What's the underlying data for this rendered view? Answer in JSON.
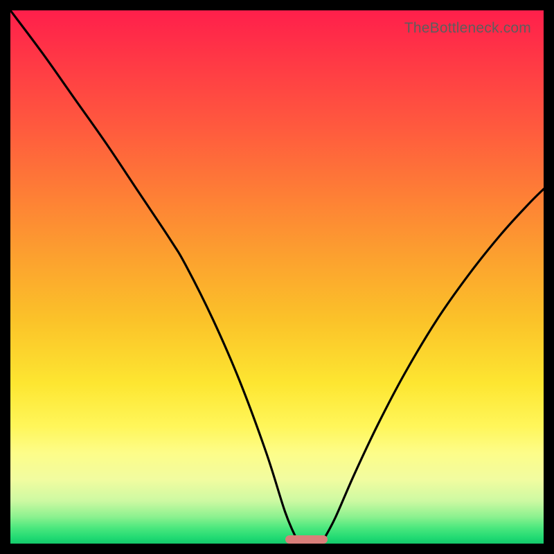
{
  "watermark": "TheBottleneck.com",
  "colors": {
    "frame": "#000000",
    "curve": "#000000",
    "pill": "#d97f7a",
    "watermark": "#5d5d5d"
  },
  "chart_data": {
    "type": "line",
    "title": "",
    "xlabel": "",
    "ylabel": "",
    "xlim": [
      0,
      100
    ],
    "ylim": [
      0,
      100
    ],
    "grid": false,
    "legend": false,
    "series": [
      {
        "name": "left-branch",
        "x": [
          0,
          6,
          12,
          18,
          24,
          30,
          33,
          38,
          43,
          48,
          51.5,
          53.5
        ],
        "y": [
          100,
          92,
          83.5,
          75,
          66,
          57,
          52,
          42,
          30.5,
          17,
          6,
          1.2
        ]
      },
      {
        "name": "right-branch",
        "x": [
          59,
          61,
          64.5,
          69,
          74,
          80,
          86,
          92,
          97,
          100
        ],
        "y": [
          1.2,
          5,
          13,
          22.5,
          32,
          42,
          50.5,
          58,
          63.5,
          66.5
        ]
      }
    ],
    "marker": {
      "name": "bottom-pill",
      "x_range": [
        51.5,
        59.5
      ],
      "y": 0.8,
      "color": "#d97f7a"
    },
    "gradient_stops": [
      {
        "pos": 0.0,
        "color": "#ff1f4b"
      },
      {
        "pos": 0.22,
        "color": "#ff5a3e"
      },
      {
        "pos": 0.46,
        "color": "#fca02f"
      },
      {
        "pos": 0.7,
        "color": "#fde631"
      },
      {
        "pos": 0.88,
        "color": "#f1fca0"
      },
      {
        "pos": 0.97,
        "color": "#4ce87e"
      },
      {
        "pos": 1.0,
        "color": "#15c96b"
      }
    ]
  }
}
